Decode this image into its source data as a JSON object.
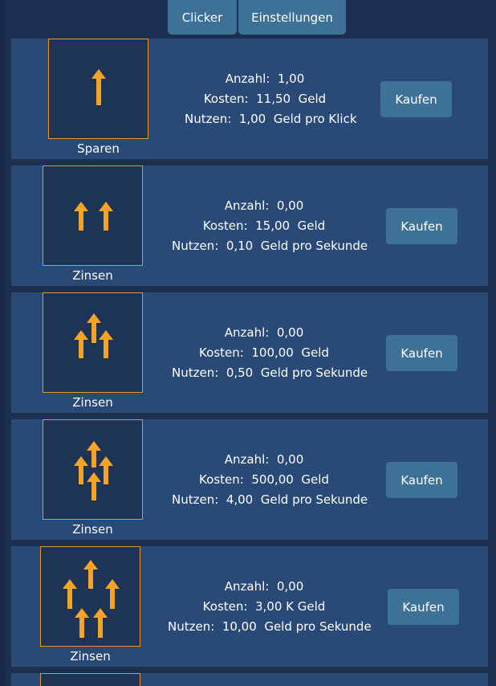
{
  "tabs": {
    "clicker": "Clicker",
    "settings": "Einstellungen"
  },
  "colors": {
    "background": "#1c2f4e",
    "card": "#294a76",
    "button": "#3e7196",
    "accent": "#f7a425",
    "border": "#e8952b"
  },
  "upgrades": [
    {
      "icon": "single-arrow-icon",
      "name": "Sparen",
      "anzahl_label": "Anzahl:",
      "anzahl": "1,00",
      "kosten_label": "Kosten:",
      "kosten": "11,50",
      "kosten_unit": "Geld",
      "nutzen_label": "Nutzen:",
      "nutzen": "1,00",
      "nutzen_unit": "Geld pro Klick",
      "button": "Kaufen"
    },
    {
      "icon": "two-arrows-icon",
      "name": "Zinsen",
      "anzahl_label": "Anzahl:",
      "anzahl": "0,00",
      "kosten_label": "Kosten:",
      "kosten": "15,00",
      "kosten_unit": "Geld",
      "nutzen_label": "Nutzen:",
      "nutzen": "0,10",
      "nutzen_unit": "Geld pro Sekunde",
      "button": "Kaufen"
    },
    {
      "icon": "three-arrows-icon",
      "name": "Zinsen",
      "anzahl_label": "Anzahl:",
      "anzahl": "0,00",
      "kosten_label": "Kosten:",
      "kosten": "100,00",
      "kosten_unit": "Geld",
      "nutzen_label": "Nutzen:",
      "nutzen": "0,50",
      "nutzen_unit": "Geld pro Sekunde",
      "button": "Kaufen"
    },
    {
      "icon": "four-arrows-icon",
      "name": "Zinsen",
      "anzahl_label": "Anzahl:",
      "anzahl": "0,00",
      "kosten_label": "Kosten:",
      "kosten": "500,00",
      "kosten_unit": "Geld",
      "nutzen_label": "Nutzen:",
      "nutzen": "4,00",
      "nutzen_unit": "Geld pro Sekunde",
      "button": "Kaufen"
    },
    {
      "icon": "five-arrows-icon",
      "name": "Zinsen",
      "anzahl_label": "Anzahl:",
      "anzahl": "0,00",
      "kosten_label": "Kosten:",
      "kosten": "3,00 K",
      "kosten_unit": "Geld",
      "nutzen_label": "Nutzen:",
      "nutzen": "10,00",
      "nutzen_unit": "Geld pro Sekunde",
      "button": "Kaufen"
    }
  ]
}
